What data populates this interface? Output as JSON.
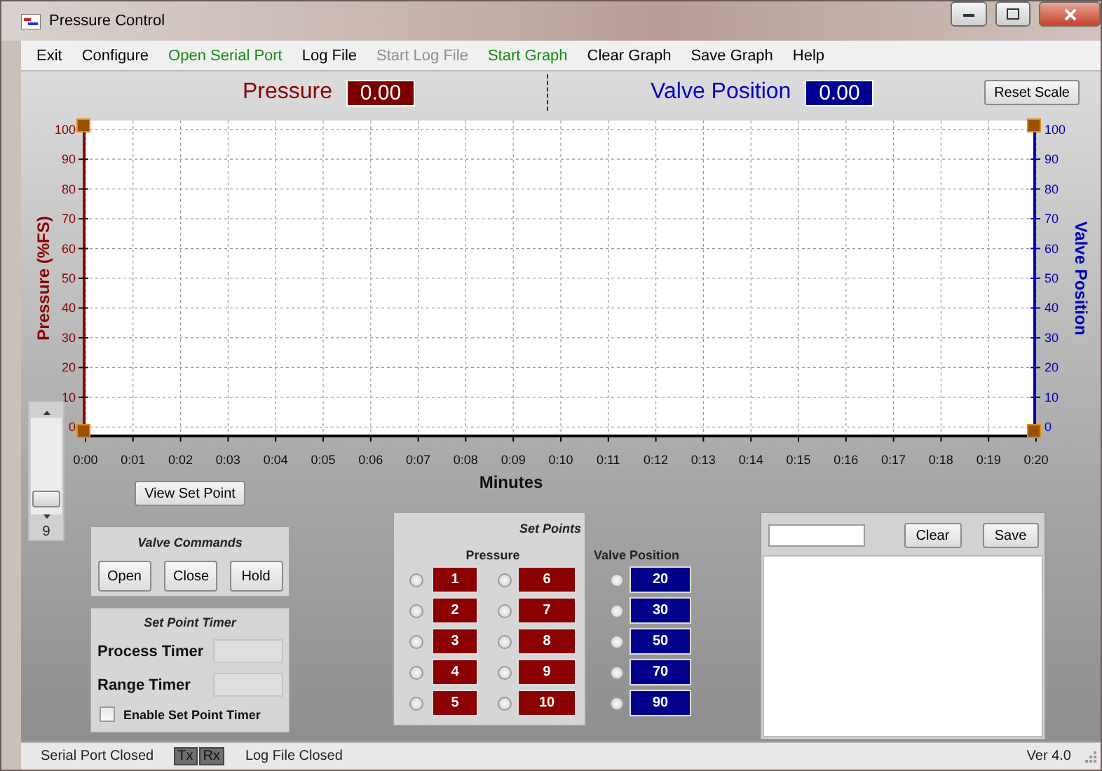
{
  "window": {
    "title": "Pressure Control"
  },
  "menu": [
    {
      "label": "Exit",
      "color": "#000000"
    },
    {
      "label": "Configure",
      "color": "#000000"
    },
    {
      "label": "Open Serial Port",
      "color": "#138a13"
    },
    {
      "label": "Log File",
      "color": "#000000"
    },
    {
      "label": "Start Log File",
      "color": "#8d8d8d"
    },
    {
      "label": "Start Graph",
      "color": "#138a13"
    },
    {
      "label": "Clear Graph",
      "color": "#000000"
    },
    {
      "label": "Save Graph",
      "color": "#000000"
    },
    {
      "label": "Help",
      "color": "#000000"
    }
  ],
  "readouts": {
    "pressure": {
      "label": "Pressure",
      "value": "0.00"
    },
    "valve": {
      "label": "Valve Position",
      "value": "0.00"
    },
    "reset_button": "Reset Scale"
  },
  "chart": {
    "chart_data": {
      "type": "line",
      "xlabel": "Minutes",
      "ylabel": "Pressure (%FS)",
      "xlim": [
        0,
        20
      ],
      "ylim": [
        -3,
        103
      ],
      "xticks": [
        {
          "value": 0,
          "label": "0:00"
        },
        {
          "value": 1,
          "label": "0:01"
        },
        {
          "value": 2,
          "label": "0:02"
        },
        {
          "value": 3,
          "label": "0:03"
        },
        {
          "value": 4,
          "label": "0:04"
        },
        {
          "value": 5,
          "label": "0:05"
        },
        {
          "value": 6,
          "label": "0:06"
        },
        {
          "value": 7,
          "label": "0:07"
        },
        {
          "value": 8,
          "label": "0:08"
        },
        {
          "value": 9,
          "label": "0:09"
        },
        {
          "value": 10,
          "label": "0:10"
        },
        {
          "value": 11,
          "label": "0:11"
        },
        {
          "value": 12,
          "label": "0:12"
        },
        {
          "value": 13,
          "label": "0:13"
        },
        {
          "value": 14,
          "label": "0:14"
        },
        {
          "value": 15,
          "label": "0:15"
        },
        {
          "value": 16,
          "label": "0:16"
        },
        {
          "value": 17,
          "label": "0:17"
        },
        {
          "value": 18,
          "label": "0:18"
        },
        {
          "value": 19,
          "label": "0:19"
        },
        {
          "value": 20,
          "label": "0:20"
        }
      ],
      "grid": true,
      "yticks": [
        {
          "value": 100,
          "label": "100"
        },
        {
          "value": 90,
          "label": "90"
        },
        {
          "value": 80,
          "label": "80"
        },
        {
          "value": 70,
          "label": "70"
        },
        {
          "value": 60,
          "label": "60"
        },
        {
          "value": 50,
          "label": "50"
        },
        {
          "value": 40,
          "label": "40"
        },
        {
          "value": 30,
          "label": "30"
        },
        {
          "value": 20,
          "label": "20"
        },
        {
          "value": 10,
          "label": "10"
        },
        {
          "value": 0,
          "label": "0"
        }
      ]
    },
    "right_axis": {
      "label": "Valve Position",
      "ticks": [
        "100",
        "90",
        "80",
        "70",
        "60",
        "50",
        "40",
        "30",
        "20",
        "10",
        "0"
      ]
    }
  },
  "scale_control": {
    "value": "9",
    "level": 0.1
  },
  "view_set_point_button": "View Set Point",
  "valve_commands": {
    "title": "Valve Commands",
    "buttons": [
      "Open",
      "Close",
      "Hold"
    ]
  },
  "set_point_timer": {
    "title": "Set Point Timer",
    "fields": [
      {
        "label": "Process Timer"
      },
      {
        "label": "Range Timer"
      }
    ],
    "checkbox": {
      "label": "Enable Set Point Timer",
      "checked": false
    }
  },
  "set_points": {
    "title": "Set Points",
    "pressure_header": "Pressure",
    "valve_header": "Valve Position",
    "pressure": [
      {
        "value": "1",
        "selected": false
      },
      {
        "value": "2",
        "selected": false
      },
      {
        "value": "3",
        "selected": false
      },
      {
        "value": "4",
        "selected": false
      },
      {
        "value": "5",
        "selected": false
      },
      {
        "value": "6",
        "selected": false
      },
      {
        "value": "7",
        "selected": false
      },
      {
        "value": "8",
        "selected": false
      },
      {
        "value": "9",
        "selected": false
      },
      {
        "value": "10",
        "selected": false
      }
    ],
    "valve": [
      {
        "value": "20",
        "selected": false
      },
      {
        "value": "30",
        "selected": false
      },
      {
        "value": "50",
        "selected": false
      },
      {
        "value": "70",
        "selected": false
      },
      {
        "value": "90",
        "selected": false
      }
    ]
  },
  "log_panel": {
    "buttons": [
      "Clear",
      "Save"
    ]
  },
  "status_bar": {
    "serial": "Serial Port Closed",
    "tx": "Tx",
    "rx": "Rx",
    "log": "Log File Closed",
    "version": "Ver 4.0"
  }
}
